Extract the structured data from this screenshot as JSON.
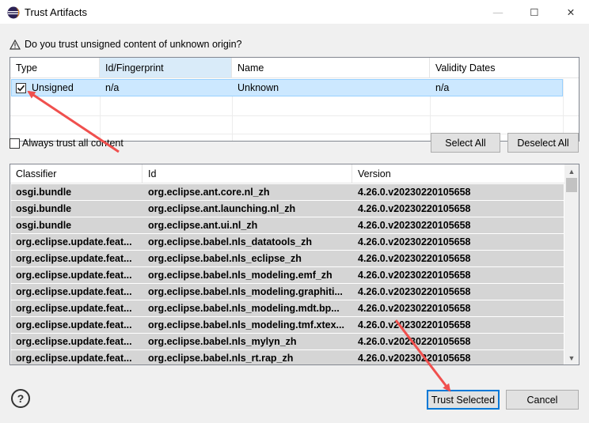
{
  "window": {
    "title": "Trust Artifacts",
    "minimize_glyph": "—",
    "maximize_glyph": "☐",
    "close_glyph": "✕"
  },
  "question": {
    "icon": "warning-triangle-icon",
    "text": "Do you trust unsigned content of unknown origin?"
  },
  "signers_table": {
    "columns": [
      "Type",
      "Id/Fingerprint",
      "Name",
      "Validity Dates"
    ],
    "rows": [
      {
        "checked": true,
        "type": "Unsigned",
        "id": "n/a",
        "name": "Unknown",
        "validity": "n/a"
      }
    ]
  },
  "always_trust": {
    "label": "Always trust all content",
    "checked": false
  },
  "select_all_label": "Select All",
  "deselect_all_label": "Deselect All",
  "artifacts_table": {
    "columns": [
      "Classifier",
      "Id",
      "Version"
    ],
    "rows": [
      {
        "classifier": "osgi.bundle",
        "id": "org.eclipse.ant.core.nl_zh",
        "version": "4.26.0.v20230220105658"
      },
      {
        "classifier": "osgi.bundle",
        "id": "org.eclipse.ant.launching.nl_zh",
        "version": "4.26.0.v20230220105658"
      },
      {
        "classifier": "osgi.bundle",
        "id": "org.eclipse.ant.ui.nl_zh",
        "version": "4.26.0.v20230220105658"
      },
      {
        "classifier": "org.eclipse.update.feat...",
        "id": "org.eclipse.babel.nls_datatools_zh",
        "version": "4.26.0.v20230220105658"
      },
      {
        "classifier": "org.eclipse.update.feat...",
        "id": "org.eclipse.babel.nls_eclipse_zh",
        "version": "4.26.0.v20230220105658"
      },
      {
        "classifier": "org.eclipse.update.feat...",
        "id": "org.eclipse.babel.nls_modeling.emf_zh",
        "version": "4.26.0.v20230220105658"
      },
      {
        "classifier": "org.eclipse.update.feat...",
        "id": "org.eclipse.babel.nls_modeling.graphiti...",
        "version": "4.26.0.v20230220105658"
      },
      {
        "classifier": "org.eclipse.update.feat...",
        "id": "org.eclipse.babel.nls_modeling.mdt.bp...",
        "version": "4.26.0.v20230220105658"
      },
      {
        "classifier": "org.eclipse.update.feat...",
        "id": "org.eclipse.babel.nls_modeling.tmf.xtex...",
        "version": "4.26.0.v20230220105658"
      },
      {
        "classifier": "org.eclipse.update.feat...",
        "id": "org.eclipse.babel.nls_mylyn_zh",
        "version": "4.26.0.v20230220105658"
      },
      {
        "classifier": "org.eclipse.update.feat...",
        "id": "org.eclipse.babel.nls_rt.rap_zh",
        "version": "4.26.0.v20230220105658"
      }
    ]
  },
  "help_glyph": "?",
  "trust_selected_label": "Trust Selected",
  "cancel_label": "Cancel",
  "colors": {
    "accent": "#0078d7",
    "selection": "#cce8ff",
    "row_gray": "#d5d5d5",
    "annotation_arrow": "#f0504e"
  }
}
